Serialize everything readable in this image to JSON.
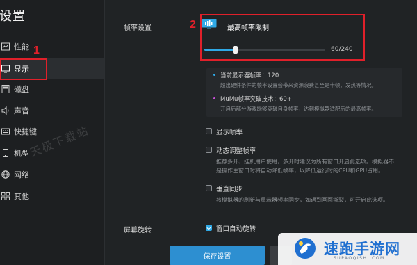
{
  "sidebar": {
    "title": "设置",
    "items": [
      {
        "label": "性能",
        "icon": "chart-icon"
      },
      {
        "label": "显示",
        "icon": "monitor-icon"
      },
      {
        "label": "磁盘",
        "icon": "disk-icon"
      },
      {
        "label": "声音",
        "icon": "speaker-icon"
      },
      {
        "label": "快捷键",
        "icon": "keyboard-icon"
      },
      {
        "label": "机型",
        "icon": "phone-icon"
      },
      {
        "label": "网络",
        "icon": "globe-icon"
      },
      {
        "label": "其他",
        "icon": "grid-icon"
      }
    ],
    "active_index": 1
  },
  "annotations": {
    "box1_number": "1",
    "box2_number": "2",
    "color": "#e0202a"
  },
  "framerate": {
    "section_label": "帧率设置",
    "limit_title": "最高帧率限制",
    "slider_value_text": "60/240",
    "slider_current": 60,
    "slider_max": 240,
    "slider_color": "#2fa9e6",
    "info": {
      "current_title": "当前显示器帧率：120",
      "current_desc": "超出硬件条件的帧率设置会带来资源浪费甚至是卡顿、发热等情况。",
      "mumu_title": "MuMu帧率突破技术：60+",
      "mumu_desc": "开启后部分游戏能够突破自身帧率，达到模拟器适配后的最高帧率。"
    },
    "options": {
      "show_fps": "显示帧率",
      "dynamic_fps": "动态调整帧率",
      "dynamic_desc_1": "推荐多开、挂机用户使用，多开时建议为所有窗口开启此选项。模拟器不",
      "dynamic_desc_2": "是操作主窗口时将自动降低帧率，以降低运行时的CPU和GPU占用。",
      "vsync": "垂直同步",
      "vsync_desc": "将模拟器的刷新与显示器频率同步，如遇到画面撕裂，可开启此选项。"
    }
  },
  "rotation": {
    "section_label": "屏幕旋转",
    "auto_rotate": "窗口自动旋转",
    "auto_rotate_checked": true
  },
  "footer": {
    "save_label": "保存设置"
  },
  "watermark": "天极下载站",
  "brand": {
    "name": "速跑手游网",
    "url": "SUPAOQISHI.COM",
    "color": "#1f6fd0"
  }
}
